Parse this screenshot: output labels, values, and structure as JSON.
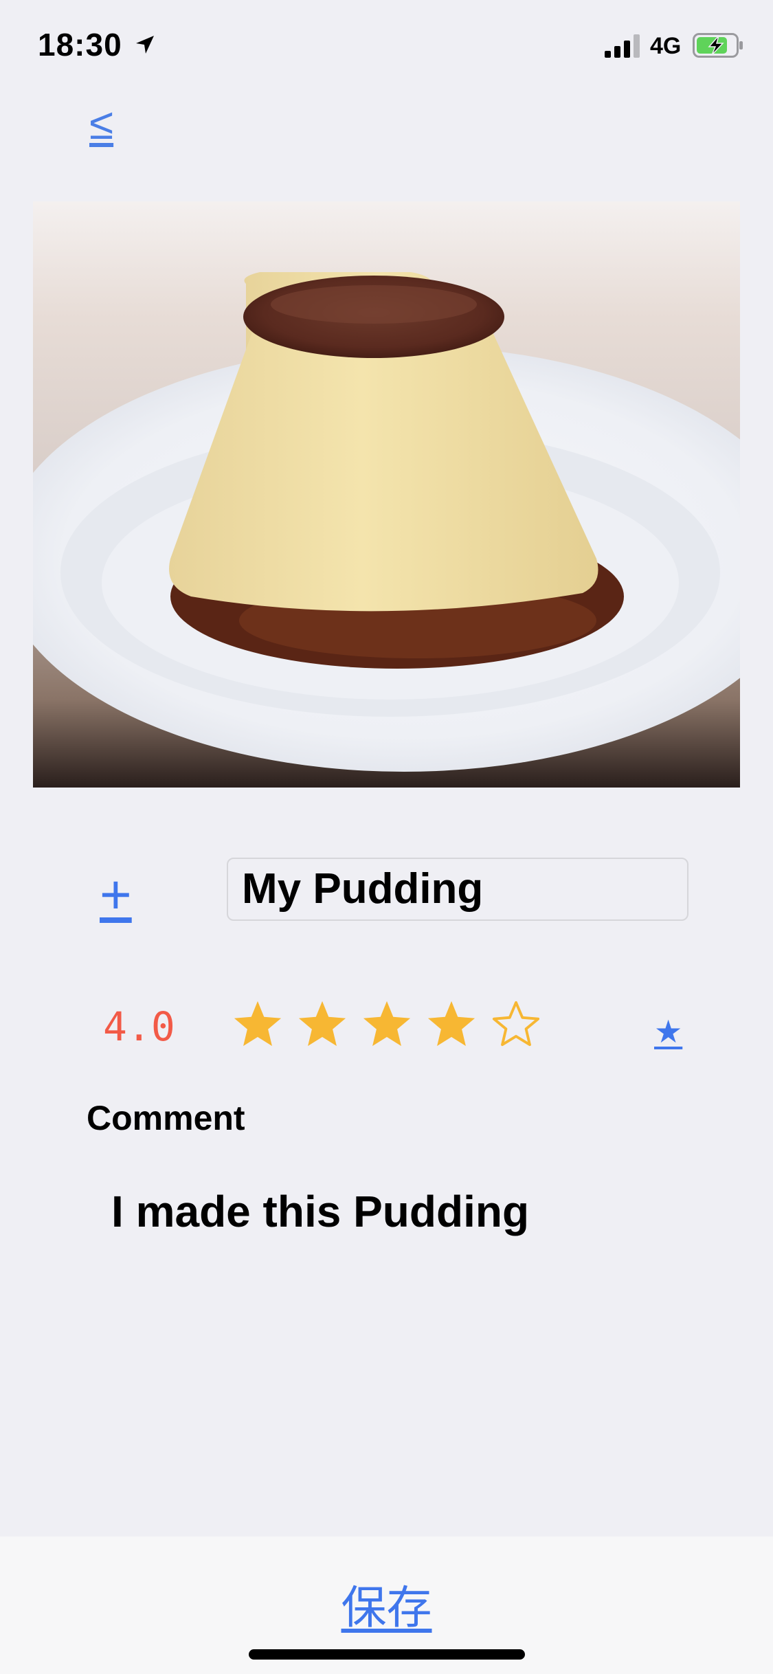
{
  "status_bar": {
    "time": "18:30",
    "network": "4G",
    "location_icon": "location-arrow-icon",
    "signal_icon": "signal-bars-icon",
    "battery_icon": "battery-charging-icon"
  },
  "nav": {
    "back_label": "≤"
  },
  "photo": {
    "description_icon": "pudding-photo"
  },
  "editor": {
    "add_photo_label": "+",
    "name_value": "My Pudding"
  },
  "rating": {
    "value_text": "4.0",
    "value": 4,
    "max": 5,
    "favorite_label": "★",
    "colors": {
      "value": "#f25a47",
      "star": "#f7b733",
      "accent": "#3f76ec"
    }
  },
  "comment": {
    "label": "Comment",
    "text": "I made this Pudding"
  },
  "footer": {
    "save_label": "保存"
  }
}
